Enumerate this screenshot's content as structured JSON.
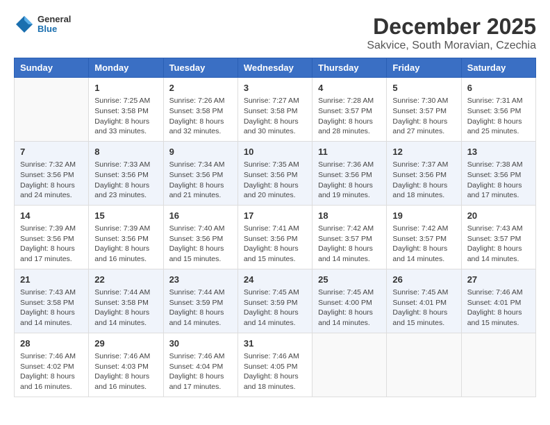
{
  "logo": {
    "general": "General",
    "blue": "Blue"
  },
  "title": "December 2025",
  "subtitle": "Sakvice, South Moravian, Czechia",
  "weekdays": [
    "Sunday",
    "Monday",
    "Tuesday",
    "Wednesday",
    "Thursday",
    "Friday",
    "Saturday"
  ],
  "weeks": [
    [
      {
        "day": "",
        "info": ""
      },
      {
        "day": "1",
        "info": "Sunrise: 7:25 AM\nSunset: 3:58 PM\nDaylight: 8 hours\nand 33 minutes."
      },
      {
        "day": "2",
        "info": "Sunrise: 7:26 AM\nSunset: 3:58 PM\nDaylight: 8 hours\nand 32 minutes."
      },
      {
        "day": "3",
        "info": "Sunrise: 7:27 AM\nSunset: 3:58 PM\nDaylight: 8 hours\nand 30 minutes."
      },
      {
        "day": "4",
        "info": "Sunrise: 7:28 AM\nSunset: 3:57 PM\nDaylight: 8 hours\nand 28 minutes."
      },
      {
        "day": "5",
        "info": "Sunrise: 7:30 AM\nSunset: 3:57 PM\nDaylight: 8 hours\nand 27 minutes."
      },
      {
        "day": "6",
        "info": "Sunrise: 7:31 AM\nSunset: 3:56 PM\nDaylight: 8 hours\nand 25 minutes."
      }
    ],
    [
      {
        "day": "7",
        "info": "Sunrise: 7:32 AM\nSunset: 3:56 PM\nDaylight: 8 hours\nand 24 minutes."
      },
      {
        "day": "8",
        "info": "Sunrise: 7:33 AM\nSunset: 3:56 PM\nDaylight: 8 hours\nand 23 minutes."
      },
      {
        "day": "9",
        "info": "Sunrise: 7:34 AM\nSunset: 3:56 PM\nDaylight: 8 hours\nand 21 minutes."
      },
      {
        "day": "10",
        "info": "Sunrise: 7:35 AM\nSunset: 3:56 PM\nDaylight: 8 hours\nand 20 minutes."
      },
      {
        "day": "11",
        "info": "Sunrise: 7:36 AM\nSunset: 3:56 PM\nDaylight: 8 hours\nand 19 minutes."
      },
      {
        "day": "12",
        "info": "Sunrise: 7:37 AM\nSunset: 3:56 PM\nDaylight: 8 hours\nand 18 minutes."
      },
      {
        "day": "13",
        "info": "Sunrise: 7:38 AM\nSunset: 3:56 PM\nDaylight: 8 hours\nand 17 minutes."
      }
    ],
    [
      {
        "day": "14",
        "info": "Sunrise: 7:39 AM\nSunset: 3:56 PM\nDaylight: 8 hours\nand 17 minutes."
      },
      {
        "day": "15",
        "info": "Sunrise: 7:39 AM\nSunset: 3:56 PM\nDaylight: 8 hours\nand 16 minutes."
      },
      {
        "day": "16",
        "info": "Sunrise: 7:40 AM\nSunset: 3:56 PM\nDaylight: 8 hours\nand 15 minutes."
      },
      {
        "day": "17",
        "info": "Sunrise: 7:41 AM\nSunset: 3:56 PM\nDaylight: 8 hours\nand 15 minutes."
      },
      {
        "day": "18",
        "info": "Sunrise: 7:42 AM\nSunset: 3:57 PM\nDaylight: 8 hours\nand 14 minutes."
      },
      {
        "day": "19",
        "info": "Sunrise: 7:42 AM\nSunset: 3:57 PM\nDaylight: 8 hours\nand 14 minutes."
      },
      {
        "day": "20",
        "info": "Sunrise: 7:43 AM\nSunset: 3:57 PM\nDaylight: 8 hours\nand 14 minutes."
      }
    ],
    [
      {
        "day": "21",
        "info": "Sunrise: 7:43 AM\nSunset: 3:58 PM\nDaylight: 8 hours\nand 14 minutes."
      },
      {
        "day": "22",
        "info": "Sunrise: 7:44 AM\nSunset: 3:58 PM\nDaylight: 8 hours\nand 14 minutes."
      },
      {
        "day": "23",
        "info": "Sunrise: 7:44 AM\nSunset: 3:59 PM\nDaylight: 8 hours\nand 14 minutes."
      },
      {
        "day": "24",
        "info": "Sunrise: 7:45 AM\nSunset: 3:59 PM\nDaylight: 8 hours\nand 14 minutes."
      },
      {
        "day": "25",
        "info": "Sunrise: 7:45 AM\nSunset: 4:00 PM\nDaylight: 8 hours\nand 14 minutes."
      },
      {
        "day": "26",
        "info": "Sunrise: 7:45 AM\nSunset: 4:01 PM\nDaylight: 8 hours\nand 15 minutes."
      },
      {
        "day": "27",
        "info": "Sunrise: 7:46 AM\nSunset: 4:01 PM\nDaylight: 8 hours\nand 15 minutes."
      }
    ],
    [
      {
        "day": "28",
        "info": "Sunrise: 7:46 AM\nSunset: 4:02 PM\nDaylight: 8 hours\nand 16 minutes."
      },
      {
        "day": "29",
        "info": "Sunrise: 7:46 AM\nSunset: 4:03 PM\nDaylight: 8 hours\nand 16 minutes."
      },
      {
        "day": "30",
        "info": "Sunrise: 7:46 AM\nSunset: 4:04 PM\nDaylight: 8 hours\nand 17 minutes."
      },
      {
        "day": "31",
        "info": "Sunrise: 7:46 AM\nSunset: 4:05 PM\nDaylight: 8 hours\nand 18 minutes."
      },
      {
        "day": "",
        "info": ""
      },
      {
        "day": "",
        "info": ""
      },
      {
        "day": "",
        "info": ""
      }
    ]
  ]
}
